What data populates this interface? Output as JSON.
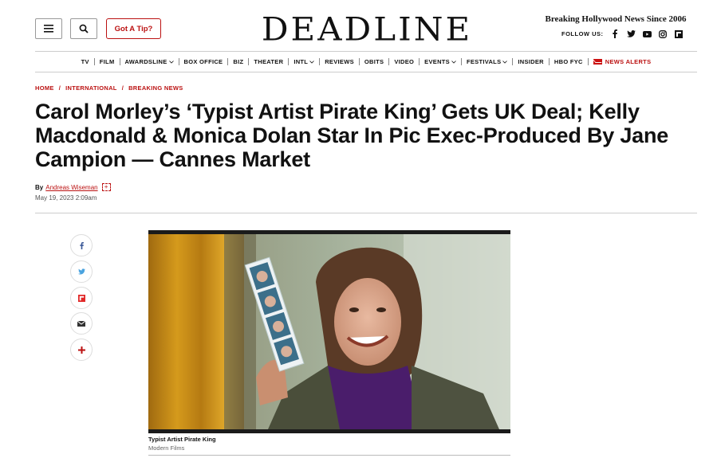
{
  "header": {
    "menu_icon": "hamburger-icon",
    "search_icon": "search-icon",
    "tip_label": "Got A Tip?",
    "logo": "DEADLINE",
    "tagline": "Breaking Hollywood News Since 2006",
    "follow_label": "FOLLOW US:",
    "social_icons": [
      "facebook-icon",
      "twitter-icon",
      "youtube-icon",
      "instagram-icon",
      "flipboard-icon"
    ]
  },
  "nav": {
    "items": [
      "TV",
      "FILM",
      "AWARDSLINE",
      "BOX OFFICE",
      "BIZ",
      "THEATER",
      "INTL",
      "REVIEWS",
      "OBITS",
      "VIDEO",
      "EVENTS",
      "FESTIVALS",
      "INSIDER",
      "HBO FYC"
    ],
    "dropdown_items": [
      "AWARDSLINE",
      "INTL",
      "EVENTS",
      "FESTIVALS"
    ],
    "alerts_label": "NEWS ALERTS"
  },
  "breadcrumbs": [
    "HOME",
    "INTERNATIONAL",
    "BREAKING NEWS"
  ],
  "article": {
    "headline": "Carol Morley’s ‘Typist Artist Pirate King’ Gets UK Deal; Kelly Macdonald & Monica Dolan Star In Pic Exec-Produced By Jane Campion — Cannes Market",
    "by_label": "By",
    "author": "Andreas Wiseman",
    "date": "May 19, 2023 2:09am",
    "caption_title": "Typist Artist Pirate King",
    "caption_credit": "Modern Films"
  },
  "share_buttons": [
    "facebook-icon",
    "twitter-icon",
    "flipboard-icon",
    "email-icon",
    "plus-icon"
  ],
  "colors": {
    "accent": "#bb1111",
    "text": "#111111"
  }
}
